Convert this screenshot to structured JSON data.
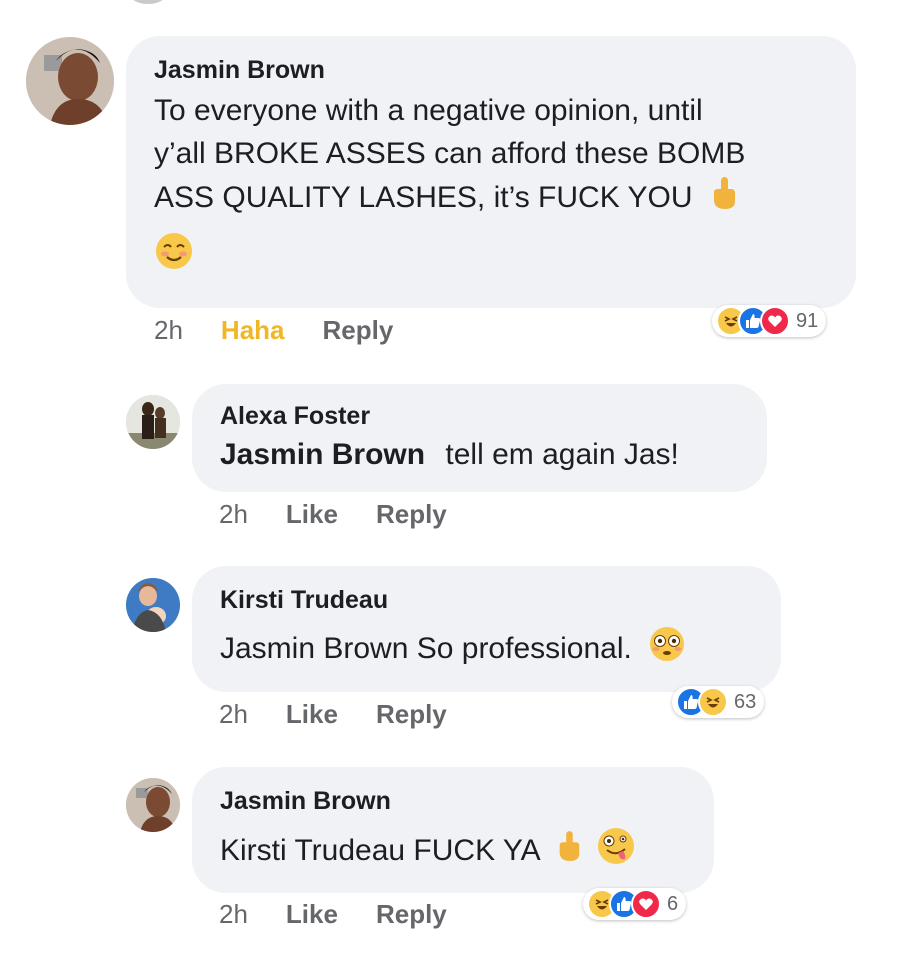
{
  "colors": {
    "bubble_bg": "#f0f2f5",
    "meta_text": "#65676b",
    "haha_active": "#f0b623",
    "like_blue": "#1b74e4",
    "love_red": "#f02849",
    "haha_yellow": "#f7c84a"
  },
  "comments": [
    {
      "author": "Jasmin Brown",
      "mention": "",
      "text_lines": [
        "To everyone with a negative opinion, until",
        "y’all BROKE ASSES can afford these BOMB",
        "ASS QUALITY LASHES, it’s FUCK YOU"
      ],
      "trailing_emoji": [
        "middle-finger-emoji",
        "smiling-blush-emoji"
      ],
      "time": "2h",
      "reaction_action": "Haha",
      "reply": "Reply",
      "reactions": [
        "haha",
        "like",
        "love"
      ],
      "reaction_count": "91"
    },
    {
      "author": "Alexa Foster",
      "mention": "Jasmin Brown",
      "text": "tell em again Jas!",
      "time": "2h",
      "reaction_action": "Like",
      "reply": "Reply"
    },
    {
      "author": "Kirsti Trudeau",
      "mention": "",
      "text": "Jasmin Brown So professional.",
      "trailing_emoji": [
        "flushed-emoji"
      ],
      "time": "2h",
      "reaction_action": "Like",
      "reply": "Reply",
      "reactions": [
        "like",
        "haha"
      ],
      "reaction_count": "63"
    },
    {
      "author": "Jasmin Brown",
      "mention": "",
      "text": "Kirsti Trudeau FUCK YA",
      "trailing_emoji": [
        "middle-finger-emoji",
        "zany-face-emoji"
      ],
      "time": "2h",
      "reaction_action": "Like",
      "reply": "Reply",
      "reactions": [
        "haha",
        "like",
        "love"
      ],
      "reaction_count": "6"
    }
  ]
}
